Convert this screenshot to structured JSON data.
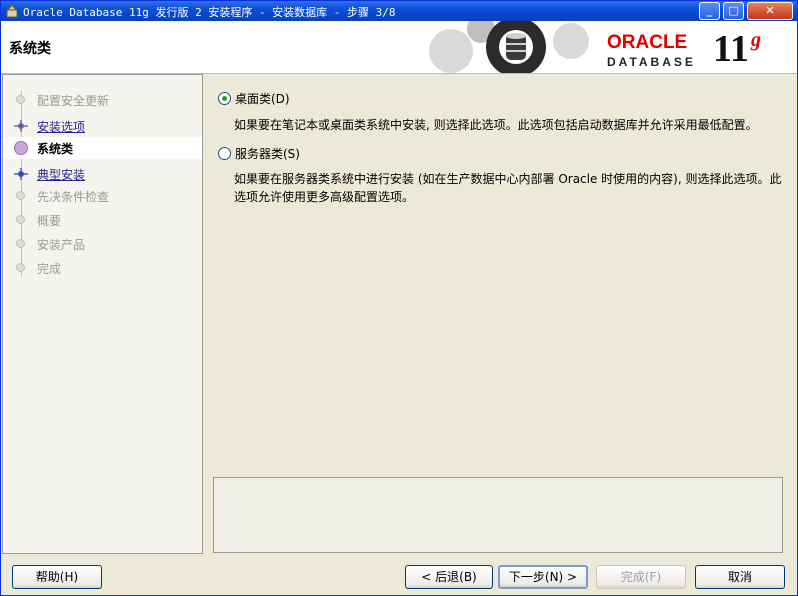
{
  "window": {
    "title": "Oracle Database 11g 发行版 2 安装程序 - 安装数据库 - 步骤 3/8"
  },
  "header": {
    "page_title": "系统类",
    "logo_oracle": "ORACLE",
    "logo_database": "DATABASE",
    "logo_version": "11",
    "logo_suffix": "g"
  },
  "sidebar": {
    "steps": [
      {
        "label": "配置安全更新",
        "state": "done"
      },
      {
        "label": "安装选项",
        "state": "link"
      },
      {
        "label": "系统类",
        "state": "current"
      },
      {
        "label": "典型安装",
        "state": "link"
      },
      {
        "label": "先决条件检查",
        "state": "pending"
      },
      {
        "label": "概要",
        "state": "pending"
      },
      {
        "label": "安装产品",
        "state": "pending"
      },
      {
        "label": "完成",
        "state": "pending"
      }
    ]
  },
  "options": [
    {
      "label": "桌面类(D)",
      "checked": true,
      "description": "如果要在笔记本或桌面类系统中安装, 则选择此选项。此选项包括启动数据库并允许采用最低配置。"
    },
    {
      "label": "服务器类(S)",
      "checked": false,
      "description": "如果要在服务器类系统中进行安装 (如在生产数据中心内部署 Oracle 时使用的内容), 则选择此选项。此选项允许使用更多高级配置选项。"
    }
  ],
  "buttons": {
    "help": "帮助(H)",
    "back": "< 后退(B)",
    "next": "下一步(N) >",
    "finish": "完成(F)",
    "cancel": "取消"
  },
  "colors": {
    "title_bar": "#0b4fd8",
    "oracle_red": "#e00000",
    "link": "#24238f",
    "radio_fill": "#21a121"
  }
}
